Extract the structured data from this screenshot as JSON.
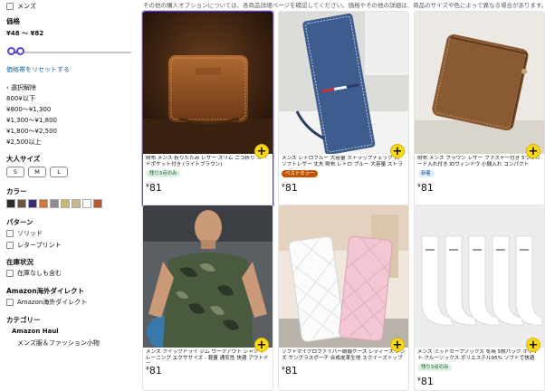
{
  "notice": "その他の購入オプションについては、各商品詳細ページを確認してください。価格やその他の詳細は、商品のサイズや色によって異なる場合があります。",
  "sidebar": {
    "mens": "メンズ",
    "price_heading": "価格",
    "price_range": "¥48 ～ ¥82",
    "price_reset": "価格帯をリセットする",
    "clear": "‹ 選択解除",
    "price_options": [
      "800¥以下",
      "¥800～¥1,300",
      "¥1,300～¥1,800",
      "¥1,800～¥2,500",
      "¥2,500以上"
    ],
    "size_heading": "大人サイズ",
    "sizes": [
      "S",
      "M",
      "L"
    ],
    "color_heading": "カラー",
    "colors": [
      "#2b2b2b",
      "#6a5140",
      "#3a2b7a",
      "#d9743a",
      "#8c8c8c",
      "#c8b878",
      "#c9b78e",
      "#ffffff",
      "#b9582f"
    ],
    "pattern_heading": "パターン",
    "patterns": [
      "ソリッド",
      "レタープリント"
    ],
    "stock_heading": "在庫状況",
    "stock_option": "在庫なしも含む",
    "intl_heading": "Amazon海外ダイレクト",
    "intl_option": "Amazon海外ダイレクト",
    "category_heading": "カテゴリー",
    "category_parent": "Amazon Haul",
    "category_child": "メンズ服＆ファッション小物"
  },
  "products": [
    {
      "title": "財布 メンズ 折りたたみ レザー スリム 二つ折り カードポケット付き (ライトブラウン)",
      "badge": "残り3点のみ",
      "badge_type": "ltd",
      "price": "81"
    },
    {
      "title": "メンズ レトロブルー 大容量 ストラップチェック 柄 ソフトレザー 丈夫 財布 レトロ ブルー 大容量 ストラップ",
      "badge": "ベストセラー",
      "badge_type": "best",
      "price": "81"
    },
    {
      "title": "財布 メンズ ブラウン レザー ファスナー付き 5つのカード入れ付き IDウィンドウ 小銭入れ コンパクト",
      "badge": "新着",
      "badge_type": "new",
      "price": "81"
    },
    {
      "title": "メンズ クイックドライ ジム ワークアウト シャツ トレーニング エクササイズ - 軽量 通気性 快適 アウトドア",
      "badge": "",
      "badge_type": "",
      "price": "81"
    },
    {
      "title": "ソフトマイクロファイバー眼鏡ケース レディース メンズ サングラスポーチ 合成皮革生地 スクイーズトップ",
      "badge": "",
      "badge_type": "",
      "price": "81"
    },
    {
      "title": "メンズ ミッドカーフソックス 冬用 5枚パック ホワイト クルーソックス ポリエステル95% ソフトで快適",
      "badge": "残り3点のみ",
      "badge_type": "ltd",
      "price": "81"
    }
  ],
  "yen_sign": "¥",
  "add_label": "+"
}
